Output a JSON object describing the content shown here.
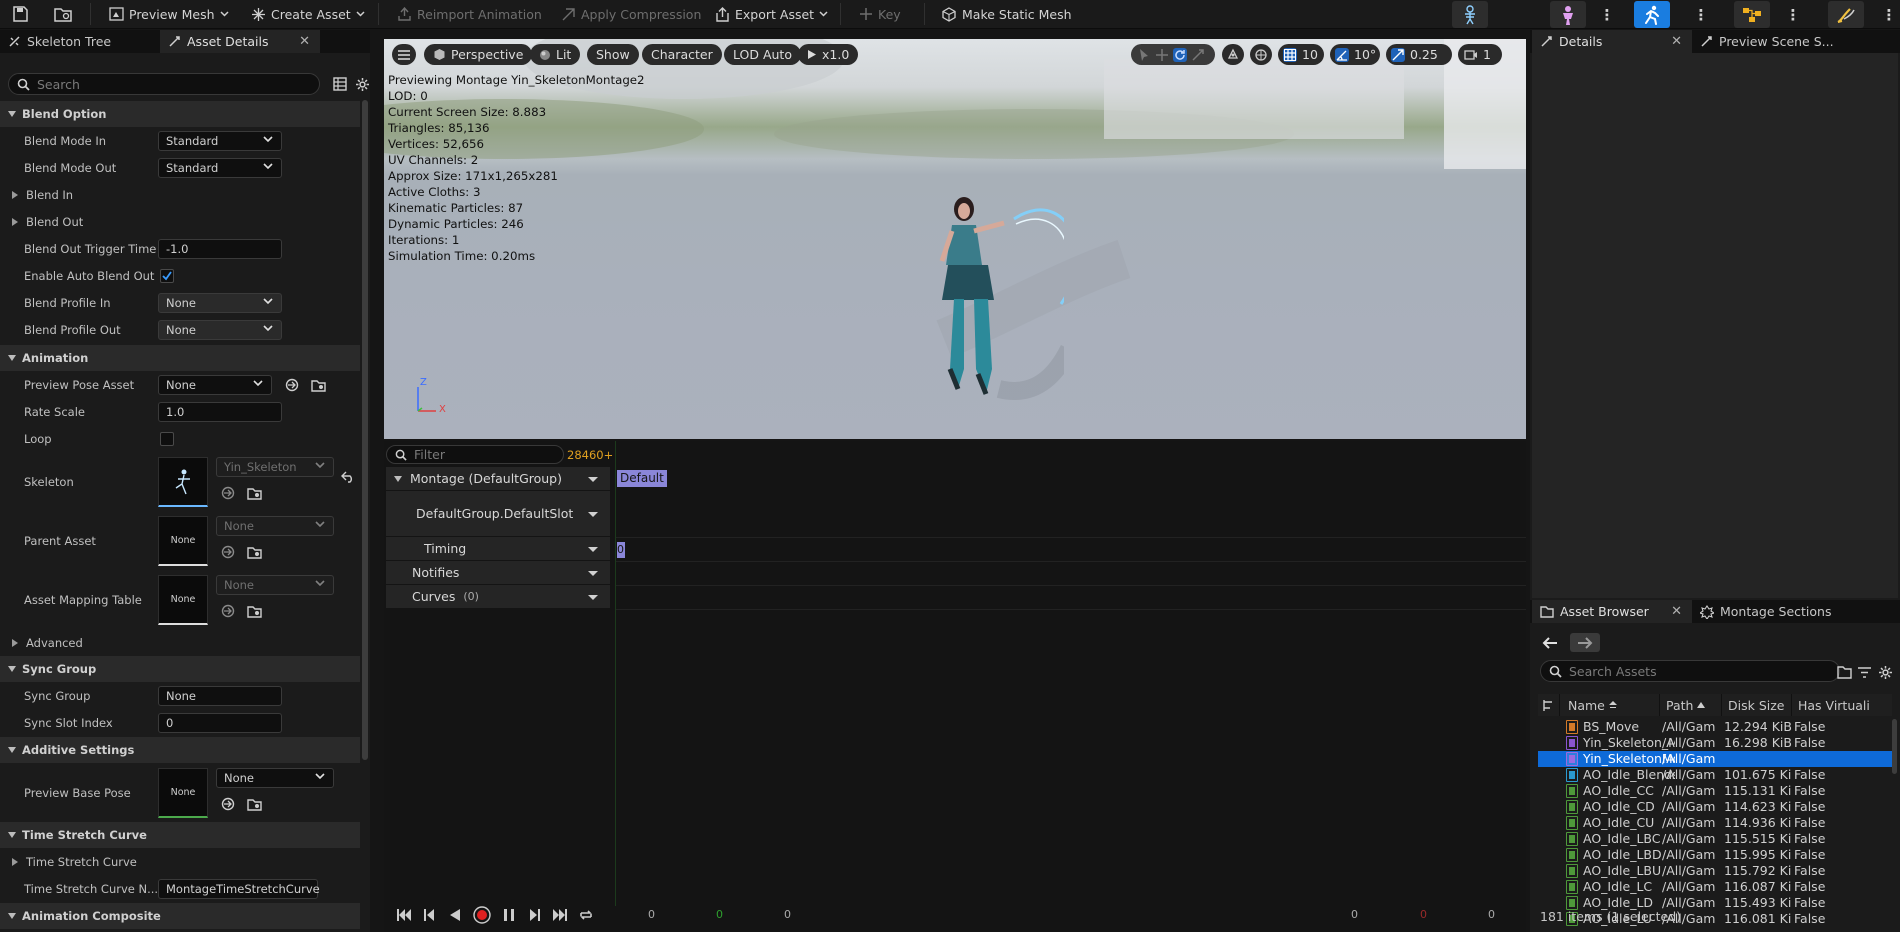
{
  "toolbar": {
    "preview_mesh": "Preview Mesh",
    "create_asset": "Create Asset",
    "reimport_animation": "Reimport Animation",
    "apply_compression": "Apply Compression",
    "export_asset": "Export Asset",
    "key": "Key",
    "make_static_mesh": "Make Static Mesh"
  },
  "left": {
    "tabs": [
      "Skeleton Tree",
      "Asset Details"
    ],
    "search_placeholder": "Search",
    "categories": {
      "blend_option": "Blend Option",
      "animation": "Animation",
      "sync_group": "Sync Group",
      "additive_settings": "Additive Settings",
      "time_stretch_curve": "Time Stretch Curve",
      "animation_composite": "Animation Composite"
    },
    "props": {
      "blend_mode_in": {
        "label": "Blend Mode In",
        "value": "Standard"
      },
      "blend_mode_out": {
        "label": "Blend Mode Out",
        "value": "Standard"
      },
      "blend_in": {
        "label": "Blend In"
      },
      "blend_out": {
        "label": "Blend Out"
      },
      "blend_out_trigger_time": {
        "label": "Blend Out Trigger Time",
        "value": "-1.0"
      },
      "enable_auto_blend_out": {
        "label": "Enable Auto Blend Out",
        "checked": true
      },
      "blend_profile_in": {
        "label": "Blend Profile In",
        "value": "None"
      },
      "blend_profile_out": {
        "label": "Blend Profile Out",
        "value": "None"
      },
      "preview_pose_asset": {
        "label": "Preview Pose Asset",
        "value": "None"
      },
      "rate_scale": {
        "label": "Rate Scale",
        "value": "1.0"
      },
      "loop": {
        "label": "Loop",
        "checked": false
      },
      "skeleton": {
        "label": "Skeleton",
        "value": "Yin_Skeleton"
      },
      "parent_asset": {
        "label": "Parent Asset",
        "value": "None",
        "thumb": "None"
      },
      "asset_mapping_table": {
        "label": "Asset Mapping Table",
        "value": "None",
        "thumb": "None"
      },
      "advanced": {
        "label": "Advanced"
      },
      "sync_group": {
        "label": "Sync Group",
        "value": "None"
      },
      "sync_slot_index": {
        "label": "Sync Slot Index",
        "value": "0"
      },
      "preview_base_pose": {
        "label": "Preview Base Pose",
        "value": "None",
        "thumb": "None"
      },
      "time_stretch_curve": {
        "label": "Time Stretch Curve"
      },
      "time_stretch_curve_name": {
        "label": "Time Stretch Curve N...",
        "value": "MontageTimeStretchCurve"
      }
    }
  },
  "viewport": {
    "buttons": {
      "perspective": "Perspective",
      "lit": "Lit",
      "show": "Show",
      "character": "Character",
      "lod": "LOD Auto",
      "speed": "x1.0",
      "grid": "10",
      "angle": "10°",
      "scale": "0.25",
      "cam": "1"
    },
    "stats": [
      "Previewing Montage Yin_SkeletonMontage2",
      "LOD: 0",
      "Current Screen Size: 8.883",
      "Triangles: 85,136",
      "Vertices: 52,656",
      "UV Channels: 2",
      "Approx Size: 171x1,265x281",
      "Active Cloths: 3",
      "Kinematic Particles: 87",
      "Dynamic Particles: 246",
      "Iterations: 1",
      "Simulation Time: 0.20ms"
    ],
    "axis": {
      "z": "Z",
      "x": "X"
    }
  },
  "timeline": {
    "filter_placeholder": "Filter",
    "frame_count": "28460+",
    "rows": {
      "montage": "Montage (DefaultGroup)",
      "slot": "DefaultGroup.DefaultSlot",
      "timing": "Timing",
      "notifies": "Notifies",
      "curves": "Curves",
      "curves_count": "(0)"
    },
    "section_label": "Default",
    "timing_marker": "0",
    "ruler": [
      "0",
      "0",
      "0",
      "0",
      "0",
      "0"
    ]
  },
  "right": {
    "top_tabs": [
      "Details",
      "Preview Scene S..."
    ],
    "bottom_tabs": [
      "Asset Browser",
      "Montage Sections"
    ],
    "search_placeholder": "Search Assets",
    "columns": [
      "Name",
      "Path",
      "Disk Size",
      "Has Virtuali"
    ],
    "assets": [
      {
        "name": "BS_Move",
        "path": "/All/Gam",
        "size": "12.294 KiB",
        "virt": "False",
        "color": "#d47a28"
      },
      {
        "name": "Yin_Skeleton_M",
        "path": "/All/Gam",
        "size": "16.298 KiB",
        "virt": "False",
        "color": "#8a55d0"
      },
      {
        "name": "Yin_SkeletonMo",
        "path": "/All/Gam",
        "size": "",
        "virt": "",
        "color": "#9b6ae0",
        "selected": true
      },
      {
        "name": "AO_Idle_Blendsp",
        "path": "/All/Gam",
        "size": "101.675 Ki",
        "virt": "False",
        "color": "#2a9ad0"
      },
      {
        "name": "AO_Idle_CC",
        "path": "/All/Gam",
        "size": "115.131 Ki",
        "virt": "False",
        "color": "#4e9a3a"
      },
      {
        "name": "AO_Idle_CD",
        "path": "/All/Gam",
        "size": "114.623 Ki",
        "virt": "False",
        "color": "#4e9a3a"
      },
      {
        "name": "AO_Idle_CU",
        "path": "/All/Gam",
        "size": "114.936 Ki",
        "virt": "False",
        "color": "#4e9a3a"
      },
      {
        "name": "AO_Idle_LBC",
        "path": "/All/Gam",
        "size": "115.515 Ki",
        "virt": "False",
        "color": "#4e9a3a"
      },
      {
        "name": "AO_Idle_LBD",
        "path": "/All/Gam",
        "size": "115.995 Ki",
        "virt": "False",
        "color": "#4e9a3a"
      },
      {
        "name": "AO_Idle_LBU",
        "path": "/All/Gam",
        "size": "115.792 Ki",
        "virt": "False",
        "color": "#4e9a3a"
      },
      {
        "name": "AO_Idle_LC",
        "path": "/All/Gam",
        "size": "116.087 Ki",
        "virt": "False",
        "color": "#4e9a3a"
      },
      {
        "name": "AO_Idle_LD",
        "path": "/All/Gam",
        "size": "115.493 Ki",
        "virt": "False",
        "color": "#4e9a3a"
      },
      {
        "name": "AO_Idle_LU",
        "path": "/All/Gam",
        "size": "116.081 Ki",
        "virt": "False",
        "color": "#4e9a3a"
      }
    ],
    "status": "181 items (1 selected)"
  }
}
